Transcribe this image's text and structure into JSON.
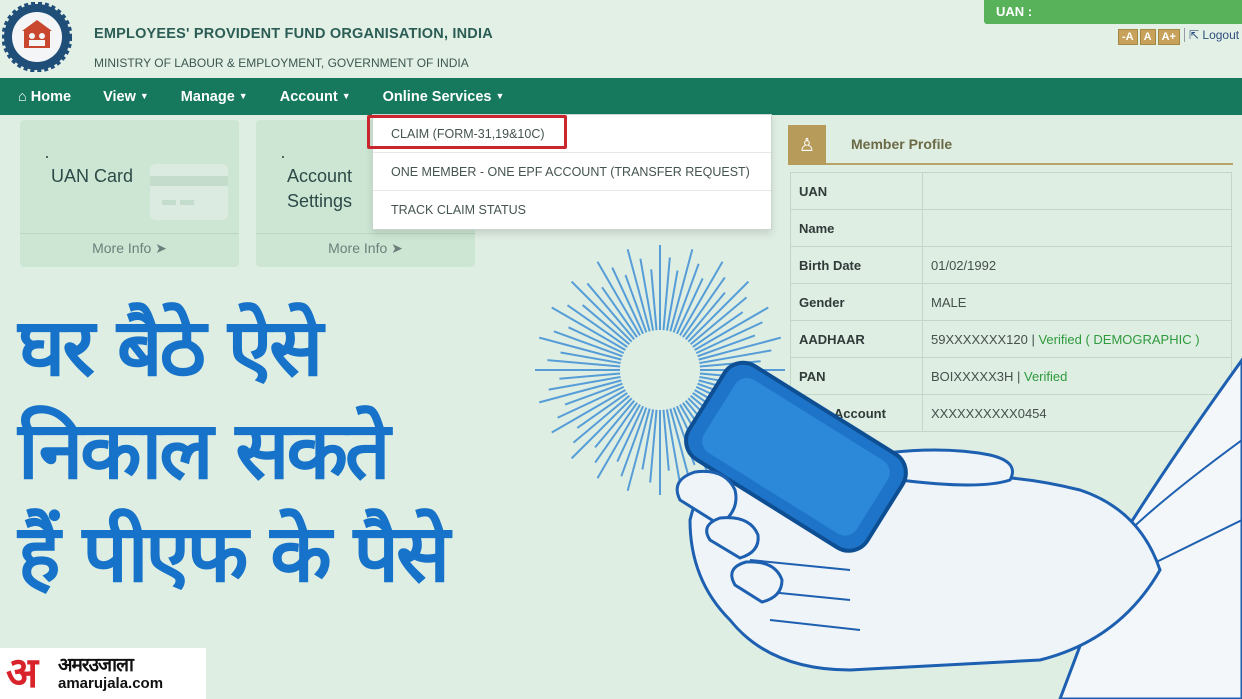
{
  "header": {
    "org_title": "EMPLOYEES' PROVIDENT FUND ORGANISATION, INDIA",
    "org_subtitle": "MINISTRY OF LABOUR & EMPLOYMENT, GOVERNMENT OF INDIA",
    "uan_label": "UAN :",
    "font_buttons": [
      "-A",
      "A",
      "A+"
    ],
    "logout_label": "Logout"
  },
  "navbar": {
    "home": "Home",
    "view": "View",
    "manage": "Manage",
    "account": "Account",
    "online_services": "Online Services"
  },
  "dropdown": {
    "items": [
      "CLAIM (FORM-31,19&10C)",
      "ONE MEMBER - ONE EPF ACCOUNT (TRANSFER REQUEST)",
      "TRACK CLAIM STATUS"
    ]
  },
  "cards": [
    {
      "line1": "UAN Card",
      "line2": "",
      "more": "More Info"
    },
    {
      "line1": "Account",
      "line2": "Settings",
      "more": "More Info"
    }
  ],
  "profile": {
    "title": "Member Profile",
    "rows": [
      {
        "label": "UAN",
        "value": "",
        "status": ""
      },
      {
        "label": "Name",
        "value": "",
        "status": ""
      },
      {
        "label": "Birth Date",
        "value": "01/02/1992",
        "status": ""
      },
      {
        "label": "Gender",
        "value": "MALE",
        "status": ""
      },
      {
        "label": "AADHAAR",
        "value": "59XXXXXXX120 |",
        "status": "Verified ( DEMOGRAPHIC )"
      },
      {
        "label": "PAN",
        "value": "BOIXXXXX3H |",
        "status": "Verified"
      },
      {
        "label": "Bank Account",
        "value": "XXXXXXXXXX0454",
        "status": ""
      }
    ]
  },
  "headline": {
    "line1": "घर बैठे ऐसे",
    "line2": "निकाल सकते",
    "line3": "हैं पीएफ के पैसे"
  },
  "brand": {
    "letter": "अ",
    "name_hindi": "अमरउजाला",
    "url": "amarujala.com"
  },
  "colors": {
    "navbar": "#16795e",
    "uan_box": "#58b25a",
    "headline": "#1673c9",
    "claim_highlight": "#c9262e",
    "verified": "#2d9a3c"
  }
}
